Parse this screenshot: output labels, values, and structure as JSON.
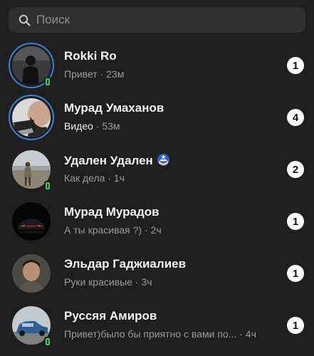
{
  "search": {
    "placeholder": "Поиск",
    "value": ""
  },
  "colors": {
    "background": "#1f1f1f",
    "story_ring": "#3d7fd9",
    "online": "#45c95a",
    "badge_bg": "#ffffff"
  },
  "chats": [
    {
      "name": "Rokki Ro",
      "message": "Привет",
      "sep": " · ",
      "time": "23м",
      "unread": "1",
      "story": true,
      "online": true,
      "avatar": "person-dark-photo"
    },
    {
      "name": "Мурад Умаханов",
      "message": "Видео",
      "sep": " · ",
      "time": "53м",
      "unread": "4",
      "story": true,
      "online": false,
      "avatar": "bearded-man-photo"
    },
    {
      "name": "Удален Удален",
      "message": "Как дела",
      "sep": " · ",
      "time": "1ч",
      "unread": "2",
      "story": false,
      "online": true,
      "avatar": "person-field-photo",
      "name_emoji": "captain-america-icon"
    },
    {
      "name": "Мурад Мурадов",
      "message": "А ты красивая ?)",
      "sep": " · ",
      "time": "2ч",
      "unread": "1",
      "story": false,
      "online": false,
      "avatar": "car-night-photo"
    },
    {
      "name": "Эльдар Гаджиалиев",
      "message": "Руки красивые",
      "sep": " · ",
      "time": "3ч",
      "unread": "1",
      "story": false,
      "online": false,
      "avatar": "man-portrait-photo"
    },
    {
      "name": "Руссяя Амиров",
      "message": "Привет)было бы приятно с вами по...",
      "sep": " · ",
      "time": "4ч",
      "unread": "1",
      "story": false,
      "online": true,
      "avatar": "car-blue-photo"
    }
  ]
}
